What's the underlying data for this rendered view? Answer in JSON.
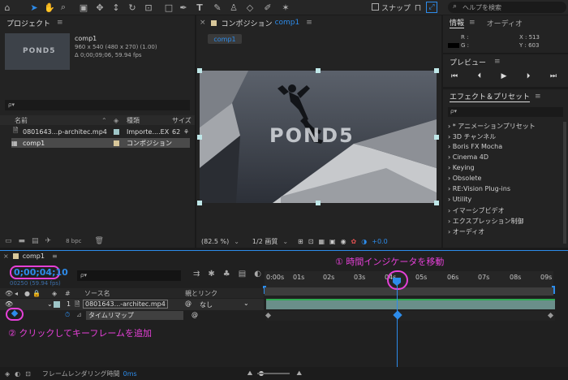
{
  "toolbar": {
    "snap_label": "スナップ",
    "search_placeholder": "ヘルプを検索"
  },
  "project": {
    "title": "プロジェクト",
    "comp_name": "comp1",
    "comp_info1": "960 x 540  (480 x 270) (1.00)",
    "comp_info2": "Δ 0;00;09;06, 59.94 fps",
    "search_placeholder": "ρ▾",
    "col_name": "名前",
    "col_type": "種類",
    "col_size": "サイズ",
    "items": [
      {
        "name": "0801643...p-architec.mp4",
        "type": "Importe....EX",
        "size": "62"
      },
      {
        "name": "comp1",
        "type": "コンポジション",
        "size": ""
      }
    ],
    "bpc": "8 bpc"
  },
  "composition": {
    "title": "コンポジション",
    "comp_link": "comp1",
    "tab": "comp1",
    "watermark": "POND5",
    "zoom": "(82.5 %)",
    "quality": "1/2 画質",
    "exposure": "+0.0"
  },
  "info": {
    "tab_info": "情報",
    "tab_audio": "オーディオ",
    "r_label": "R :",
    "g_label": "G :",
    "x_label": "X : 513",
    "y_label": "Y : 603"
  },
  "preview": {
    "title": "プレビュー"
  },
  "effects": {
    "title": "エフェクト＆プリセット",
    "search_placeholder": "ρ▾",
    "items": [
      "* アニメーションプリセット",
      "3D チャンネル",
      "Boris FX Mocha",
      "Cinema 4D",
      "Keying",
      "Obsolete",
      "RE:Vision Plug-ins",
      "Utility",
      "イマーシブビデオ",
      "エクスプレッション制御",
      "オーディオ"
    ]
  },
  "timeline": {
    "tab": "comp1",
    "timecode": "0;00;04;10",
    "frames_fps": "00250 (59.94 fps)",
    "search_placeholder": "ρ▾",
    "col_source": "ソース名",
    "col_parent": "親とリンク",
    "layer_number": "1",
    "layer_name": "0801643...-architec.mp4",
    "parent_value": "なし",
    "property": "タイムリマップ",
    "ruler": [
      "0:00s",
      "01s",
      "02s",
      "03s",
      "04s",
      "05s",
      "06s",
      "07s",
      "08s",
      "09s"
    ],
    "footer_label": "フレームレンダリング時間",
    "footer_value": "0ms"
  },
  "annotations": {
    "step1": "① 時間インジケータを移動",
    "step2": "② クリックしてキーフレームを追加"
  },
  "colors": {
    "accent_blue": "#2d8ceb",
    "annotation_pink": "#e640d8",
    "layer_bar": "#6a8f8a"
  }
}
